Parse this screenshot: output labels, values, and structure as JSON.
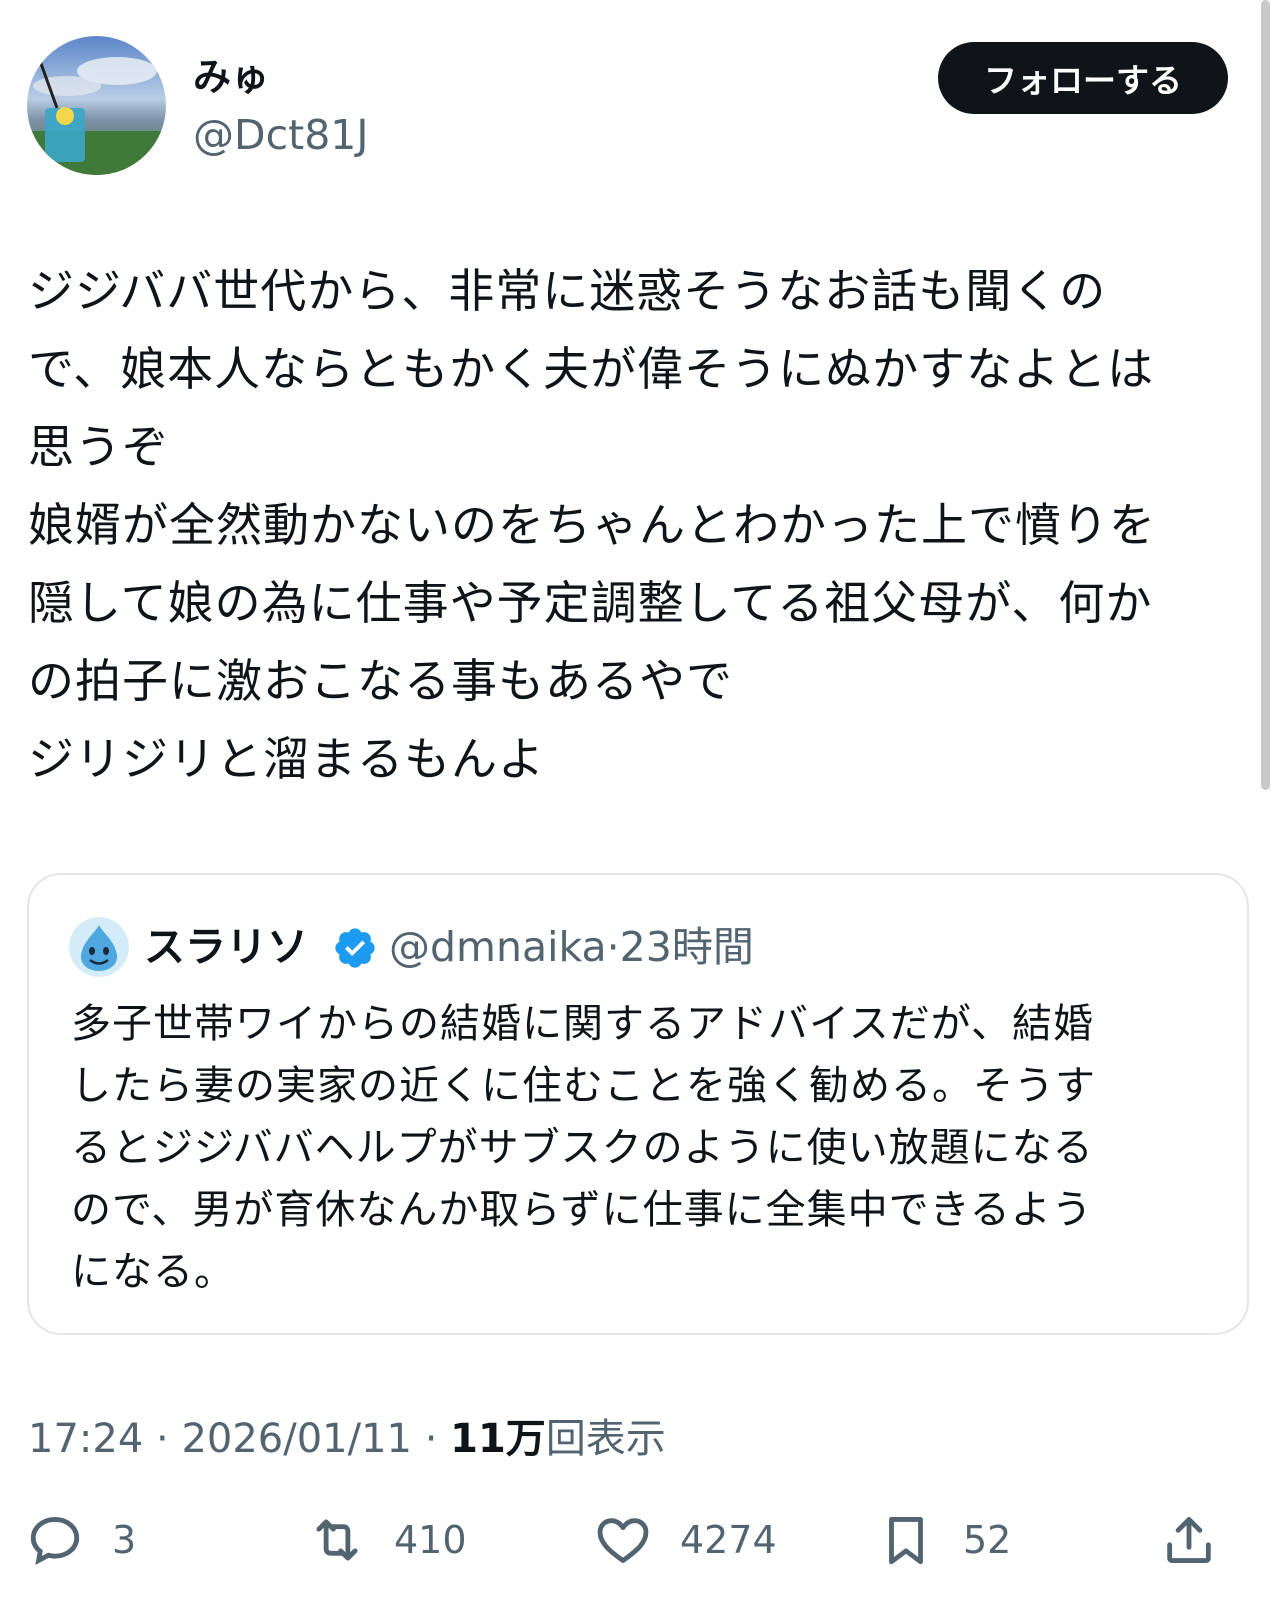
{
  "author": {
    "display_name": "みゅ",
    "handle": "@Dct81J",
    "follow_label": "フォローする"
  },
  "tweet": {
    "lines": [
      "ジジババ世代から、非常に迷惑そうなお話も聞くの",
      "で、娘本人ならともかく夫が偉そうにぬかすなよとは",
      "思うぞ",
      "娘婿が全然動かないのをちゃんとわかった上で憤りを",
      "隠して娘の為に仕事や予定調整してる祖父母が、何か",
      "の拍子に激おこなる事もあるやで",
      "ジリジリと溜まるもんよ"
    ]
  },
  "quote": {
    "display_name": "スラリソ",
    "handle": "@dmnaika",
    "separator": "·",
    "time_ago": "23時間",
    "lines": [
      "多子世帯ワイからの結婚に関するアドバイスだが、結婚",
      "したら妻の実家の近くに住むことを強く勧める。そうす",
      "るとジジババヘルプがサブスクのように使い放題になる",
      "ので、男が育休なんか取らずに仕事に全集中できるよう",
      "になる。"
    ]
  },
  "meta": {
    "time": "17:24",
    "sep1": " · ",
    "date": "2026/01/11",
    "sep2": " · ",
    "views": "11万",
    "views_label": "回表示"
  },
  "actions": {
    "replies": "3",
    "retweets": "410",
    "likes": "4274",
    "bookmarks": "52"
  },
  "icons": {
    "reply": "speech-bubble-icon",
    "retweet": "retweet-arrows-icon",
    "like": "heart-icon",
    "bookmark": "bookmark-icon",
    "share": "share-upload-icon",
    "verified": "verified-badge-icon"
  },
  "colors": {
    "text": "#0f1419",
    "muted": "#536471",
    "verified": "#1d9bf0",
    "border": "#e3e6e9"
  }
}
